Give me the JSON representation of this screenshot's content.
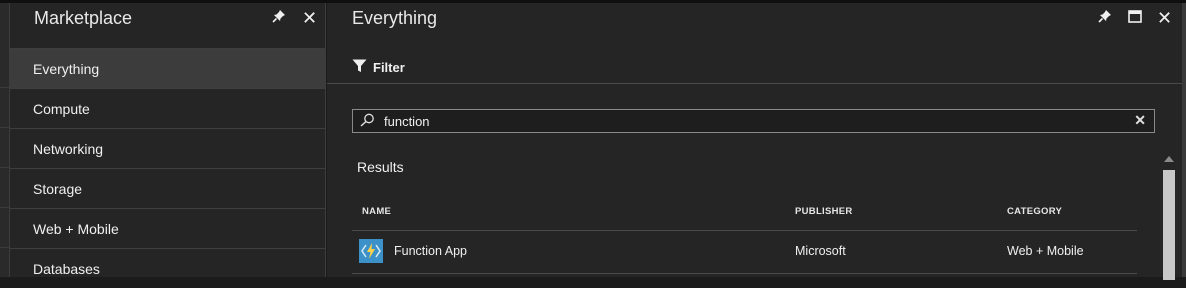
{
  "marketplace": {
    "title": "Marketplace",
    "items": [
      {
        "label": "Everything",
        "active": true
      },
      {
        "label": "Compute",
        "active": false
      },
      {
        "label": "Networking",
        "active": false
      },
      {
        "label": "Storage",
        "active": false
      },
      {
        "label": "Web + Mobile",
        "active": false
      },
      {
        "label": "Databases",
        "active": false
      }
    ]
  },
  "everything": {
    "title": "Everything",
    "filter_label": "Filter",
    "search": {
      "value": "function"
    },
    "results_label": "Results",
    "columns": {
      "name": "NAME",
      "publisher": "PUBLISHER",
      "category": "CATEGORY"
    },
    "rows": [
      {
        "name": "Function App",
        "publisher": "Microsoft",
        "category": "Web + Mobile"
      }
    ]
  },
  "icons": {
    "pin": "pin-icon",
    "close": "close-icon",
    "maximize": "maximize-icon",
    "filter": "filter-icon",
    "search": "search-icon",
    "clear": "clear-icon",
    "app": "function-app-icon"
  },
  "colors": {
    "background": "#1b1b1b",
    "blade": "#252526",
    "active_item": "#3c3c3c",
    "app_icon": "#3c91c9"
  }
}
